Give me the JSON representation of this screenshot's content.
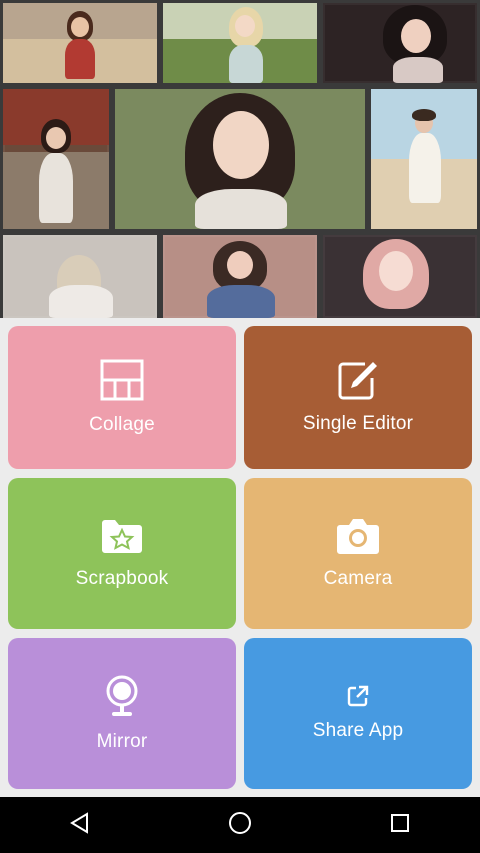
{
  "tiles": {
    "collage": {
      "label": "Collage",
      "icon": "collage-grid-icon",
      "color": "#ee9eac"
    },
    "single_editor": {
      "label": "Single Editor",
      "icon": "edit-icon",
      "color": "#a75d35"
    },
    "scrapbook": {
      "label": "Scrapbook",
      "icon": "folder-star-icon",
      "color": "#8ec35a"
    },
    "camera": {
      "label": "Camera",
      "icon": "camera-icon",
      "color": "#e5b673"
    },
    "mirror": {
      "label": "Mirror",
      "icon": "mirror-icon",
      "color": "#b98fd9"
    },
    "share_app": {
      "label": "Share App",
      "icon": "share-icon",
      "color": "#479ae1"
    }
  },
  "navbar": {
    "back": "back-icon",
    "home": "home-icon",
    "recents": "recents-icon"
  }
}
